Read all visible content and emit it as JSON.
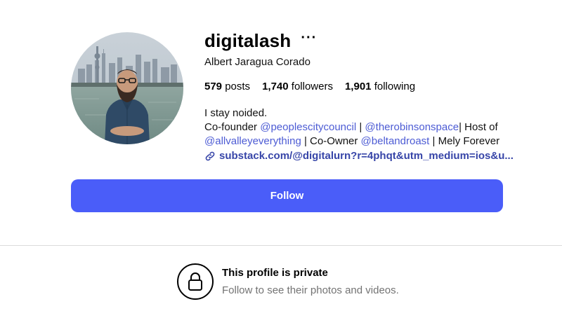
{
  "profile": {
    "username": "digitalash",
    "more_label": "···",
    "full_name": "Albert Jaragua Corado"
  },
  "stats": {
    "posts_count": "579",
    "posts_label": "posts",
    "followers_count": "1,740",
    "followers_label": "followers",
    "following_count": "1,901",
    "following_label": "following"
  },
  "bio": {
    "line1": "I stay noided.",
    "cofounder_label": "Co-founder ",
    "mention_1": "@peoplescitycouncil",
    "separator_1": " | ",
    "mention_2": "@therobinsonspace",
    "host_label": "| Host of",
    "mention_3": "@allvalleyeverything",
    "coowner_label": " | Co-Owner ",
    "mention_4": "@beltandroast",
    "tail": " | Mely Forever",
    "link_text": "substack.com/@digitalurn?r=4phqt&utm_medium=ios&u..."
  },
  "actions": {
    "follow_label": "Follow"
  },
  "private_notice": {
    "title": "This profile is private",
    "subtitle": "Follow to see their photos and videos."
  },
  "colors": {
    "accent": "#4a5df9",
    "mention": "#4c5bd4",
    "link": "#3745a8",
    "muted": "#737373"
  },
  "icons": {
    "avatar": "profile-photo",
    "more": "more-options-icon",
    "link": "link-icon",
    "lock": "lock-icon"
  }
}
